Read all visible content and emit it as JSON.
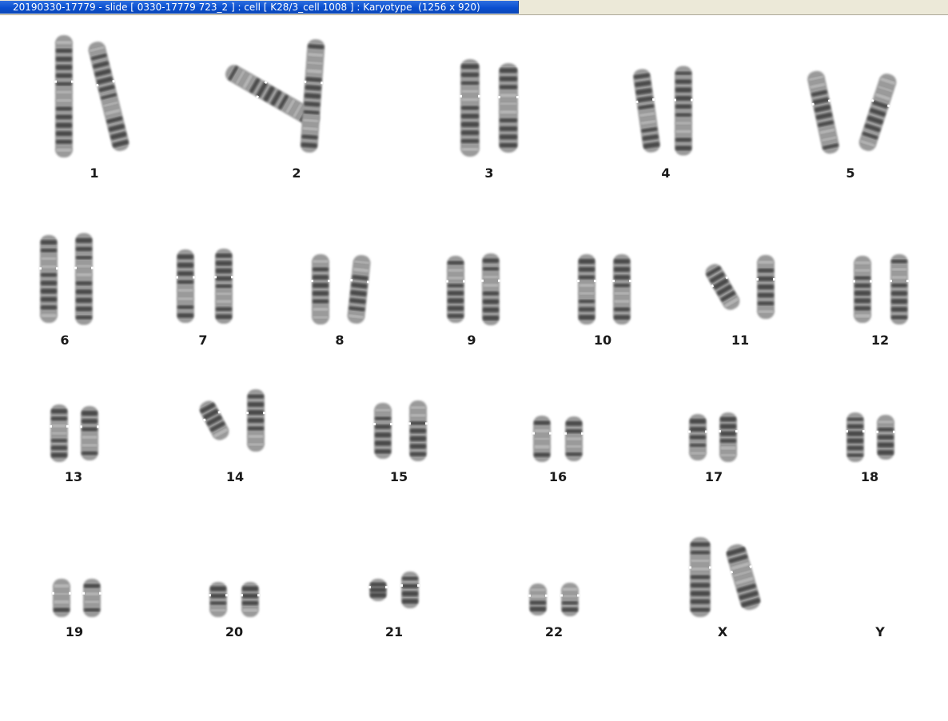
{
  "window": {
    "title": "20190330-17779 - slide [ 0330-17779 723_2 ] : cell [ K28/3_cell 1008 ] : Karyotype  (1256 x 920)"
  },
  "karyotype": {
    "chromosomes": [
      {
        "label": "1",
        "copies": 2
      },
      {
        "label": "2",
        "copies": 2
      },
      {
        "label": "3",
        "copies": 2
      },
      {
        "label": "4",
        "copies": 2
      },
      {
        "label": "5",
        "copies": 2
      },
      {
        "label": "6",
        "copies": 2
      },
      {
        "label": "7",
        "copies": 2
      },
      {
        "label": "8",
        "copies": 2
      },
      {
        "label": "9",
        "copies": 2
      },
      {
        "label": "10",
        "copies": 2
      },
      {
        "label": "11",
        "copies": 2
      },
      {
        "label": "12",
        "copies": 2
      },
      {
        "label": "13",
        "copies": 2
      },
      {
        "label": "14",
        "copies": 2
      },
      {
        "label": "15",
        "copies": 2
      },
      {
        "label": "16",
        "copies": 2
      },
      {
        "label": "17",
        "copies": 2
      },
      {
        "label": "18",
        "copies": 2
      },
      {
        "label": "19",
        "copies": 2
      },
      {
        "label": "20",
        "copies": 2
      },
      {
        "label": "21",
        "copies": 2
      },
      {
        "label": "22",
        "copies": 2
      },
      {
        "label": "X",
        "copies": 2
      },
      {
        "label": "Y",
        "copies": 0
      }
    ],
    "colors": {
      "label": "#1a1a1a",
      "chromatid": "#9a9a9a",
      "band_dark": "#2e2e2e",
      "band_light": "#c4c4c4",
      "titlebar": "#0a4fcf"
    }
  }
}
